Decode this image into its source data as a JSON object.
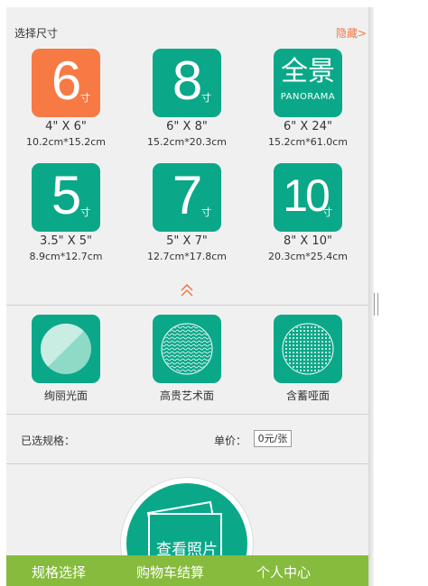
{
  "header": {
    "title": "选择尺寸",
    "hide_link": "隐藏>"
  },
  "sizes": [
    {
      "big": "6",
      "unit": "寸",
      "inches": "4\" X 6\"",
      "cm": "10.2cm*15.2cm",
      "color": "#f77a45"
    },
    {
      "big": "8",
      "unit": "寸",
      "inches": "6\" X 8\"",
      "cm": "15.2cm*20.3cm",
      "color": "#0aa889"
    },
    {
      "big": "全景",
      "sub": "PANORAMA",
      "inches": "6\" X 24\"",
      "cm": "15.2cm*61.0cm",
      "color": "#0aa889"
    },
    {
      "big": "5",
      "unit": "寸",
      "inches": "3.5\" X 5\"",
      "cm": "8.9cm*12.7cm",
      "color": "#0aa889"
    },
    {
      "big": "7",
      "unit": "寸",
      "inches": "5\" X 7\"",
      "cm": "12.7cm*17.8cm",
      "color": "#0aa889"
    },
    {
      "big": "10",
      "unit": "寸",
      "inches": "8\" X 10\"",
      "cm": "20.3cm*25.4cm",
      "color": "#0aa889"
    }
  ],
  "finishes": [
    {
      "label": "绚丽光面",
      "icon": "glossy-icon"
    },
    {
      "label": "高贵艺术面",
      "icon": "art-texture-icon"
    },
    {
      "label": "含蓄哑面",
      "icon": "matte-dots-icon"
    }
  ],
  "summary": {
    "selected_label": "已选规格：",
    "price_label": "单价：",
    "price_value": "0元/张"
  },
  "action": {
    "view_photos": "查看照片"
  },
  "bottom_nav": [
    "规格选择",
    "购物车结算",
    "个人中心"
  ],
  "colors": {
    "accent": "#0aa889",
    "selected": "#f77a45",
    "nav": "#86bb3d",
    "link": "#f07846"
  }
}
